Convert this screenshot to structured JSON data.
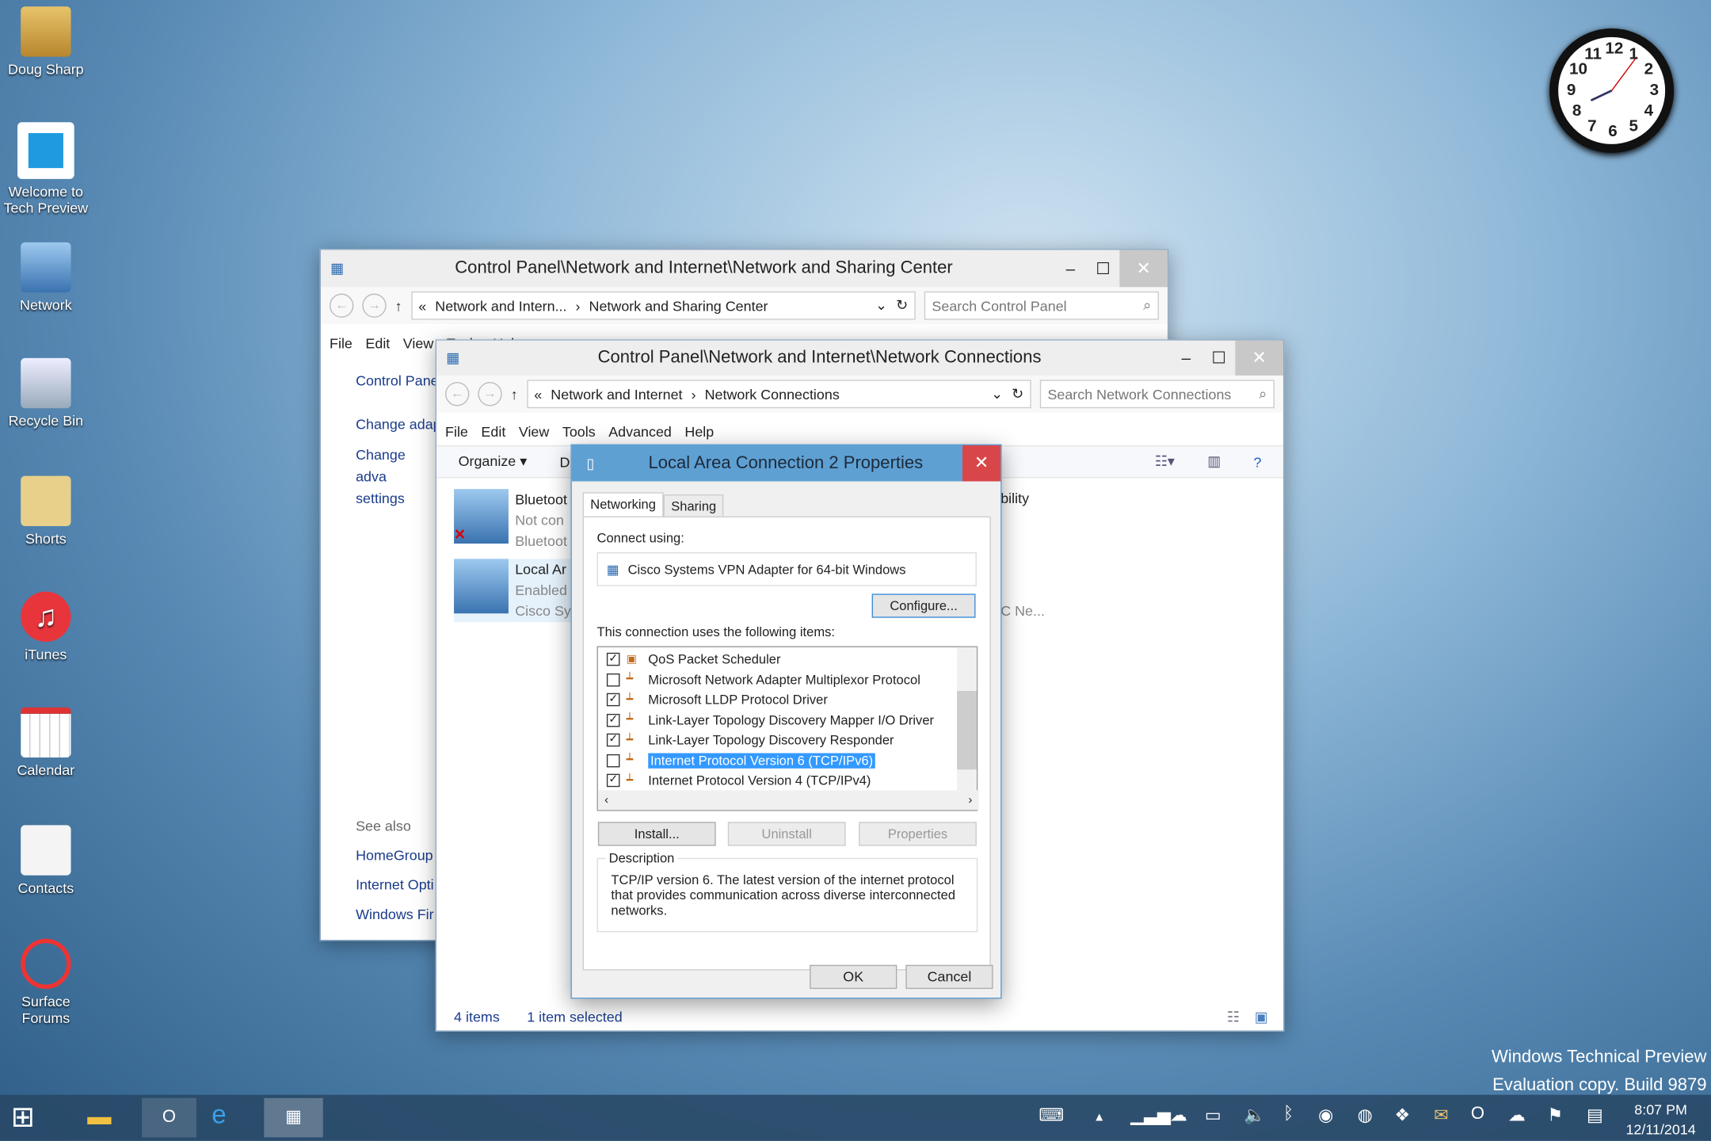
{
  "desktop": {
    "icons": [
      {
        "label": "Doug Sharp",
        "icon": "user-folder-icon"
      },
      {
        "label": "Welcome to Tech Preview",
        "icon": "windows-logo-icon"
      },
      {
        "label": "Network",
        "icon": "network-icon"
      },
      {
        "label": "Recycle Bin",
        "icon": "recycle-bin-icon"
      },
      {
        "label": "Shorts",
        "icon": "shortcut-folder-icon"
      },
      {
        "label": "iTunes",
        "icon": "itunes-icon"
      },
      {
        "label": "Calendar",
        "icon": "calendar-icon"
      },
      {
        "label": "Contacts",
        "icon": "contacts-icon"
      },
      {
        "label": "Surface Forums",
        "icon": "surface-forums-icon"
      }
    ],
    "clock_numbers": [
      "12",
      "1",
      "2",
      "3",
      "4",
      "5",
      "6",
      "7",
      "8",
      "9",
      "10",
      "11"
    ],
    "watermark": {
      "line1": "Windows Technical Preview",
      "line2": "Evaluation copy. Build 9879"
    }
  },
  "sharing_window": {
    "title": "Control Panel\\Network and Internet\\Network and Sharing Center",
    "breadcrumb": [
      "Network and Intern...",
      "Network and Sharing Center"
    ],
    "search_placeholder": "Search Control Panel",
    "menu": [
      "File",
      "Edit",
      "View",
      "Tools",
      "Help"
    ],
    "left": [
      "Control Pane",
      "Change adap",
      "Change adva settings"
    ],
    "see_also": "See also",
    "see_also_links": [
      "HomeGroup",
      "Internet Opti",
      "Windows Fir"
    ]
  },
  "connections_window": {
    "title": "Control Panel\\Network and Internet\\Network Connections",
    "breadcrumb": [
      "Network and Internet",
      "Network Connections"
    ],
    "search_placeholder": "Search Network Connections",
    "menu": [
      "File",
      "Edit",
      "View",
      "Tools",
      "Advanced",
      "Help"
    ],
    "toolbar": {
      "organize": "Organize ▾",
      "d": "D"
    },
    "items": [
      {
        "name": "Bluetoot",
        "status": "Not con",
        "device": "Bluetoot"
      },
      {
        "name": "Local Ar",
        "status": "Enabled",
        "device": "Cisco Sy"
      }
    ],
    "partial": [
      "bility",
      "C Ne..."
    ],
    "status": {
      "count": "4 items",
      "selected": "1 item selected"
    }
  },
  "dialog": {
    "title": "Local Area Connection 2 Properties",
    "tabs": [
      "Networking",
      "Sharing"
    ],
    "active_tab": "Networking",
    "connect_using_label": "Connect using:",
    "adapter": "Cisco Systems VPN Adapter for 64-bit Windows",
    "configure": "Configure...",
    "items_label": "This connection uses the following items:",
    "items": [
      {
        "label": "QoS Packet Scheduler",
        "checked": true
      },
      {
        "label": "Microsoft Network Adapter Multiplexor Protocol",
        "checked": false
      },
      {
        "label": "Microsoft LLDP Protocol Driver",
        "checked": true
      },
      {
        "label": "Link-Layer Topology Discovery Mapper I/O Driver",
        "checked": true
      },
      {
        "label": "Link-Layer Topology Discovery Responder",
        "checked": true
      },
      {
        "label": "Internet Protocol Version 6 (TCP/IPv6)",
        "checked": false,
        "selected": true
      },
      {
        "label": "Internet Protocol Version 4 (TCP/IPv4)",
        "checked": true
      }
    ],
    "install": "Install...",
    "uninstall": "Uninstall",
    "properties": "Properties",
    "description_label": "Description",
    "description": "TCP/IP version 6. The latest version of the internet protocol that provides communication across diverse interconnected networks.",
    "ok": "OK",
    "cancel": "Cancel"
  },
  "taskbar": {
    "time": "8:07 PM",
    "date": "12/11/2014"
  },
  "colors": {
    "dialog_title": "#5fa0d3",
    "close_red": "#d9464a",
    "selection": "#3399ff"
  }
}
